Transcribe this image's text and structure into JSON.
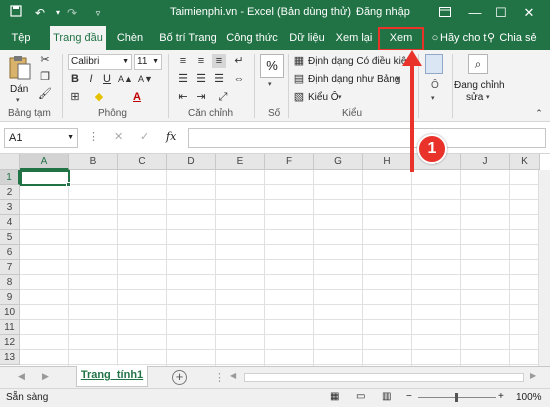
{
  "titlebar": {
    "title": "Taimienphi.vn - Excel (Bản dùng thử)",
    "login": "Đăng nhập",
    "save_icon": "save-icon",
    "undo_icon": "undo-icon",
    "redo_icon": "redo-icon",
    "customize_icon": "customize-icon",
    "ribbon_options_icon": "ribbon-options-icon",
    "minimize": "—",
    "maximize": "☐",
    "close": "✕"
  },
  "tabs": [
    {
      "label": "Tệp"
    },
    {
      "label": "Trang đầu"
    },
    {
      "label": "Chèn"
    },
    {
      "label": "Bố trí Trang"
    },
    {
      "label": "Công thức"
    },
    {
      "label": "Dữ liệu"
    },
    {
      "label": "Xem lại"
    },
    {
      "label": "Xem"
    },
    {
      "label": "Hãy cho t"
    },
    {
      "label": "Chia sẻ"
    }
  ],
  "ribbon": {
    "clipboard": {
      "paste": "Dán",
      "label": "Bảng tạm"
    },
    "font": {
      "name": "Calibri",
      "size": "11",
      "label": "Phông"
    },
    "alignment": {
      "label": "Căn chỉnh"
    },
    "number": {
      "label": "Số",
      "percent": "%"
    },
    "styles": {
      "conditional": "Định dạng Có điều kiện",
      "table": "Định dạng như Bảng",
      "cell_styles": "Kiểu Ô",
      "label": "Kiểu"
    },
    "cells": {
      "label": "Ô"
    },
    "editing": {
      "label1": "Đang chỉnh",
      "label2": "sửa"
    }
  },
  "formula_bar": {
    "name_box": "A1",
    "fx": "fx",
    "cancel": "✕",
    "enter": "✓"
  },
  "grid": {
    "columns": [
      "A",
      "B",
      "C",
      "D",
      "E",
      "F",
      "G",
      "H",
      "I",
      "J",
      "K"
    ],
    "rows": [
      "1",
      "2",
      "3",
      "4",
      "5",
      "6",
      "7",
      "8",
      "9",
      "10",
      "11",
      "12",
      "13"
    ],
    "active_cell": "A1"
  },
  "sheets": {
    "active": "Trang_tính1",
    "add": "+"
  },
  "status": {
    "text": "Sẵn sàng",
    "zoom": "100%"
  },
  "annotation": {
    "badge": "1"
  },
  "colors": {
    "brand": "#217346",
    "annotation": "#e8322a"
  }
}
